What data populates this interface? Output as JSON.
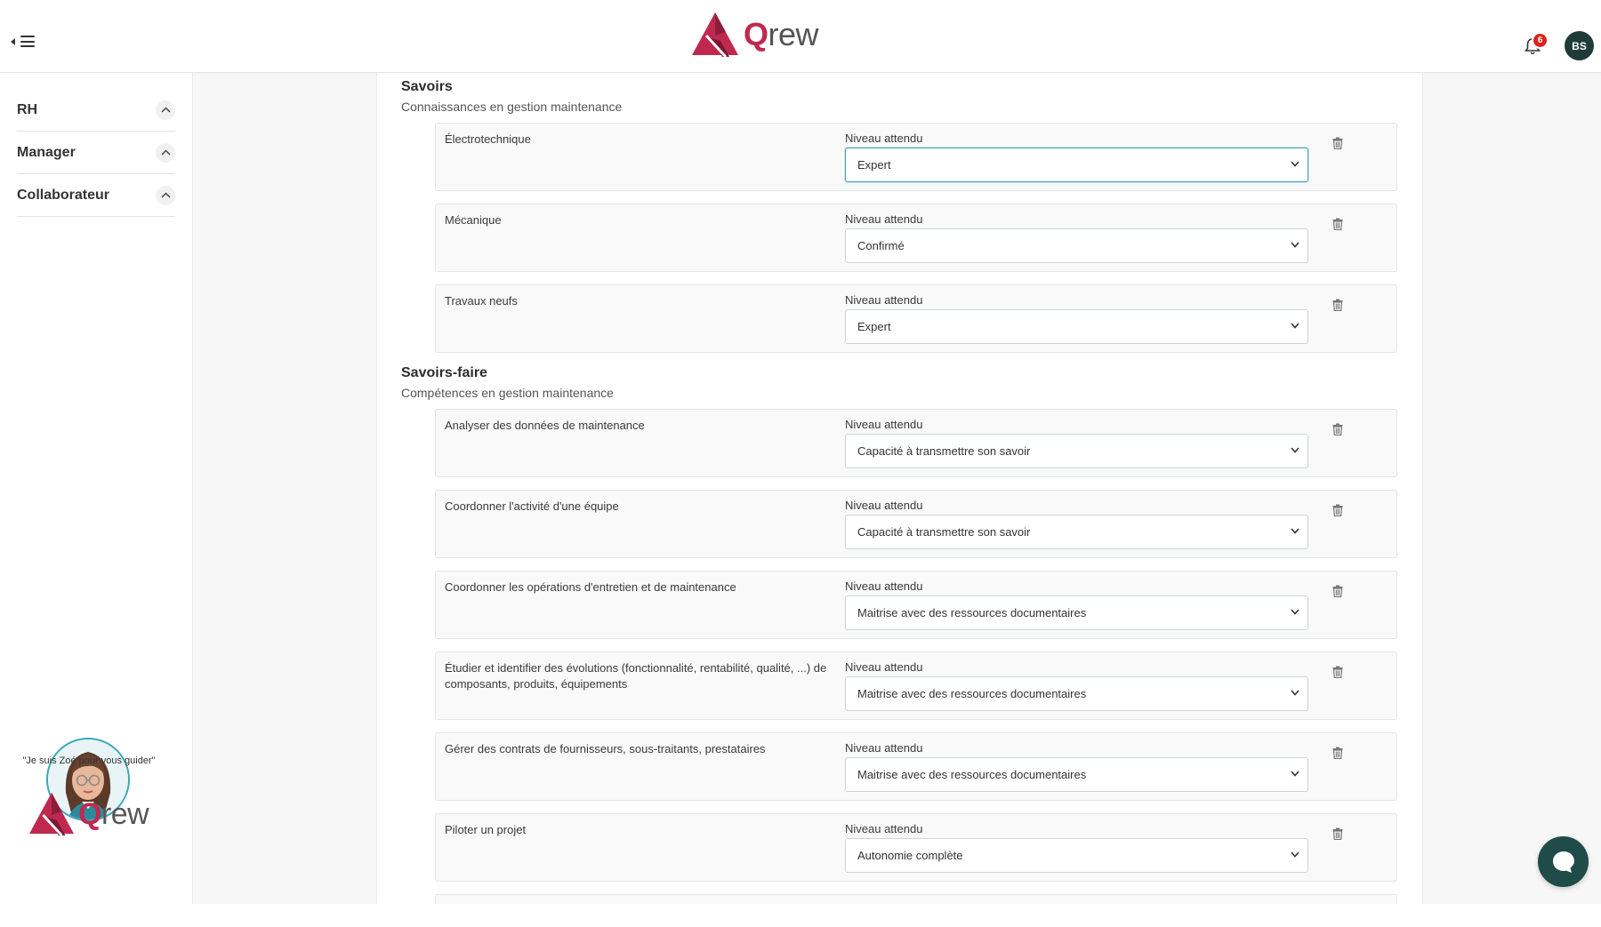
{
  "brand": {
    "name": "Qrew",
    "accent": "#c0294f",
    "dark": "#1f4b48"
  },
  "header": {
    "notifications_count": "6",
    "user_initials": "BS"
  },
  "sidebar": {
    "items": [
      {
        "label": "RH"
      },
      {
        "label": "Manager"
      },
      {
        "label": "Collaborateur"
      }
    ],
    "guide_text": "\"Je suis Zoé pour vous guider\""
  },
  "sections": [
    {
      "title": "Savoirs",
      "subtitle": "Connaissances en gestion maintenance",
      "items": [
        {
          "name": "Électrotechnique",
          "level_label": "Niveau attendu",
          "level": "Expert"
        },
        {
          "name": "Mécanique",
          "level_label": "Niveau attendu",
          "level": "Confirmé"
        },
        {
          "name": "Travaux neufs",
          "level_label": "Niveau attendu",
          "level": "Expert"
        }
      ]
    },
    {
      "title": "Savoirs-faire",
      "subtitle": "Compétences en gestion maintenance",
      "items": [
        {
          "name": "Analyser des données de maintenance",
          "level_label": "Niveau attendu",
          "level": "Capacité à transmettre son savoir"
        },
        {
          "name": "Coordonner l'activité d'une équipe",
          "level_label": "Niveau attendu",
          "level": "Capacité à transmettre son savoir"
        },
        {
          "name": "Coordonner les opérations d'entretien et de maintenance",
          "level_label": "Niveau attendu",
          "level": "Maitrise avec des ressources documentaires"
        },
        {
          "name": "Étudier et identifier des évolutions (fonctionnalité, rentabilité, qualité, ...) de composants, produits, équipements",
          "level_label": "Niveau attendu",
          "level": "Maitrise avec des ressources documentaires"
        },
        {
          "name": "Gérer des contrats de fournisseurs, sous-traitants, prestataires",
          "level_label": "Niveau attendu",
          "level": "Maitrise avec des ressources documentaires"
        },
        {
          "name": "Piloter un projet",
          "level_label": "Niveau attendu",
          "level": "Autonomie complète"
        }
      ]
    }
  ]
}
